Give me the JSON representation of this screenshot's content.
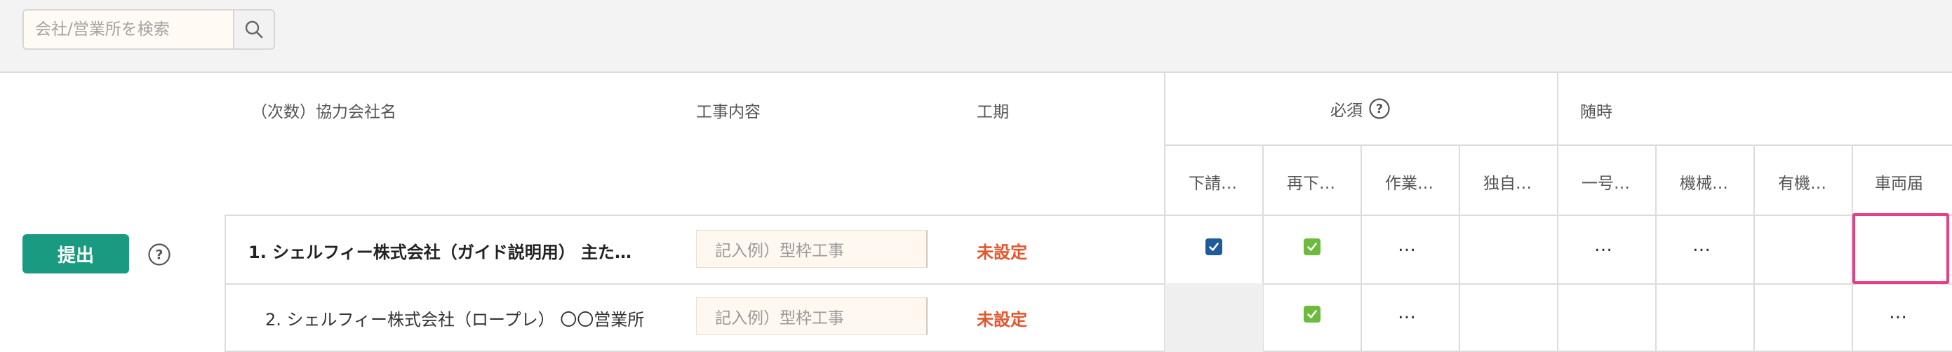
{
  "search": {
    "placeholder": "会社/営業所を検索",
    "value": ""
  },
  "headers": {
    "company": "（次数）協力会社名",
    "work": "工事内容",
    "period": "工期",
    "required": "必須",
    "optional": "随時",
    "required_cols": [
      "下請…",
      "再下…",
      "作業…",
      "独自…"
    ],
    "optional_cols": [
      "一号…",
      "機械…",
      "有機…",
      "車両届"
    ]
  },
  "submit_label": "提出",
  "rows": [
    {
      "name": "1. シェルフィー株式会社（ガイド説明用） 主たる…",
      "work_placeholder": "記入例）型枠工事",
      "period": "未設定",
      "cells": [
        "check-blue",
        "check-green",
        "…",
        "",
        "…",
        "…",
        "",
        ""
      ]
    },
    {
      "name": "2. シェルフィー株式会社（ロープレ） 〇〇営業所",
      "work_placeholder": "記入例）型枠工事",
      "period": "未設定",
      "cells": [
        "disabled",
        "check-green",
        "…",
        "",
        "",
        "",
        "",
        "…"
      ]
    }
  ],
  "colors": {
    "accent": "#1a9a80",
    "unset": "#e4572e",
    "highlight": "#e93d86",
    "check_blue": "#1d5c99",
    "check_green": "#6cbb3c"
  }
}
